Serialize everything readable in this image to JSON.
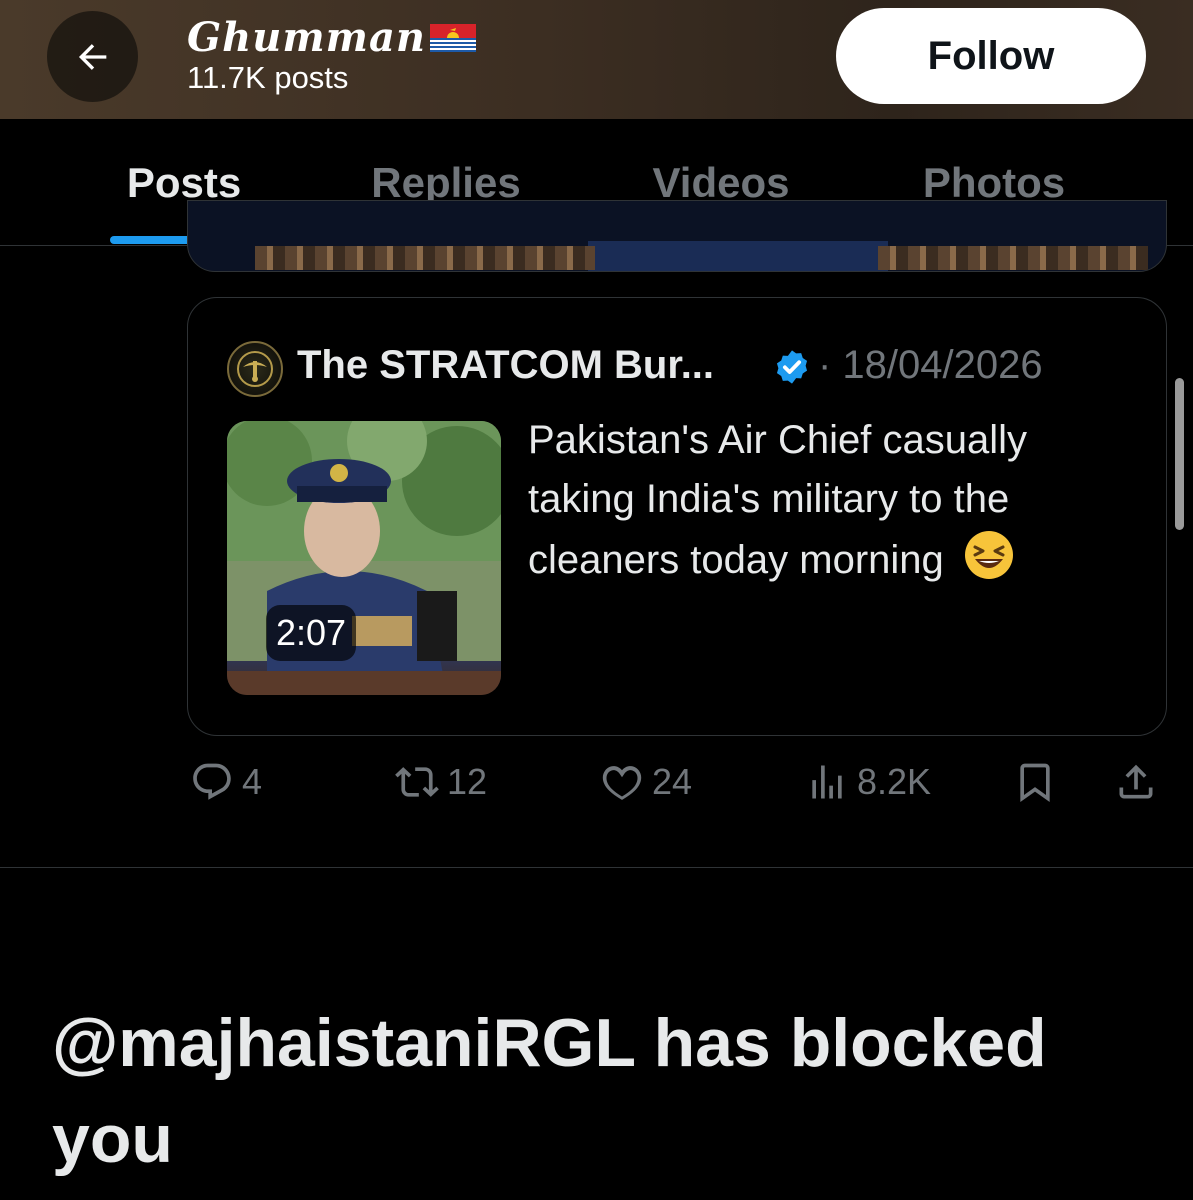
{
  "header": {
    "name": "Ghumman",
    "flag_icon": "kiribati-flag-icon",
    "posts_count": "11.7K posts",
    "follow_label": "Follow",
    "back_icon": "arrow-left-icon"
  },
  "tabs": [
    {
      "label": "Posts",
      "active": true
    },
    {
      "label": "Replies",
      "active": false
    },
    {
      "label": "Videos",
      "active": false
    },
    {
      "label": "Photos",
      "active": false
    }
  ],
  "quote": {
    "author": "The STRATCOM Bur...",
    "verified": true,
    "date": "· 18/04/2026",
    "text": "Pakistan's Air Chief casually taking India's military to the cleaners today morning",
    "emoji_icon": "laughing-face-icon",
    "video_duration": "2:07"
  },
  "actions": {
    "replies": "4",
    "reposts": "12",
    "likes": "24",
    "views": "8.2K"
  },
  "blocked_message": "@majhaistaniRGL has blocked you",
  "colors": {
    "accent": "#1d9bf0",
    "muted": "#71767b",
    "text": "#e7e9ea",
    "background": "#000000"
  }
}
